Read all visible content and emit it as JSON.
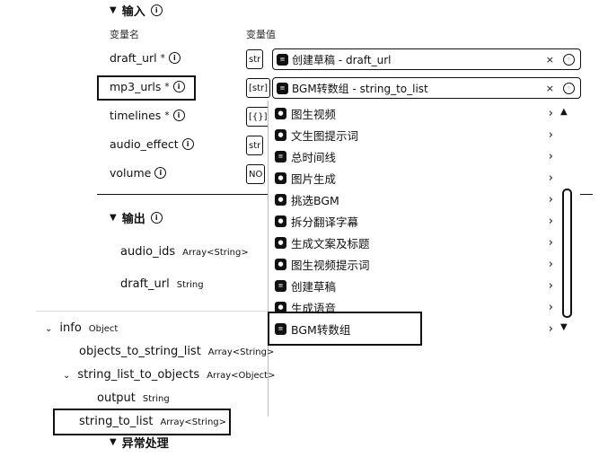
{
  "input_section": {
    "title": "输入"
  },
  "columns": {
    "name": "变量名",
    "value": "变量值"
  },
  "inputs": [
    {
      "name": "draft_url",
      "required": "*",
      "type_stub": "str",
      "ref": "创建草稿 - draft_url"
    },
    {
      "name": "mp3_urls",
      "required": "*",
      "type_stub": "[str]",
      "ref": "BGM转数组 - string_to_list"
    },
    {
      "name": "timelines",
      "required": "*",
      "type_stub": "[{}]"
    },
    {
      "name": "audio_effect",
      "required": "",
      "type_stub": "str"
    },
    {
      "name": "volume",
      "required": "",
      "type_stub": "NO"
    }
  ],
  "menu": {
    "items": [
      "图生视频",
      "文生图提示词",
      "总时间线",
      "图片生成",
      "挑选BGM",
      "拆分翻译字幕",
      "生成文案及标题",
      "图生视频提示词",
      "创建草稿",
      "生成语音",
      "BGM转数组"
    ]
  },
  "output_section": {
    "title": "输出",
    "items": [
      {
        "name": "audio_ids",
        "type": "Array<String>"
      },
      {
        "name": "draft_url",
        "type": "String"
      }
    ]
  },
  "tree": {
    "info": {
      "name": "info",
      "type": "Object"
    },
    "objects_to_string_list": {
      "name": "objects_to_string_list",
      "type": "Array<String>"
    },
    "string_list_to_objects": {
      "name": "string_list_to_objects",
      "type": "Array<Object>"
    },
    "output": {
      "name": "output",
      "type": "String"
    },
    "string_to_list": {
      "name": "string_to_list",
      "type": "Array<String>"
    }
  },
  "bottom_section": {
    "title": "异常处理"
  }
}
